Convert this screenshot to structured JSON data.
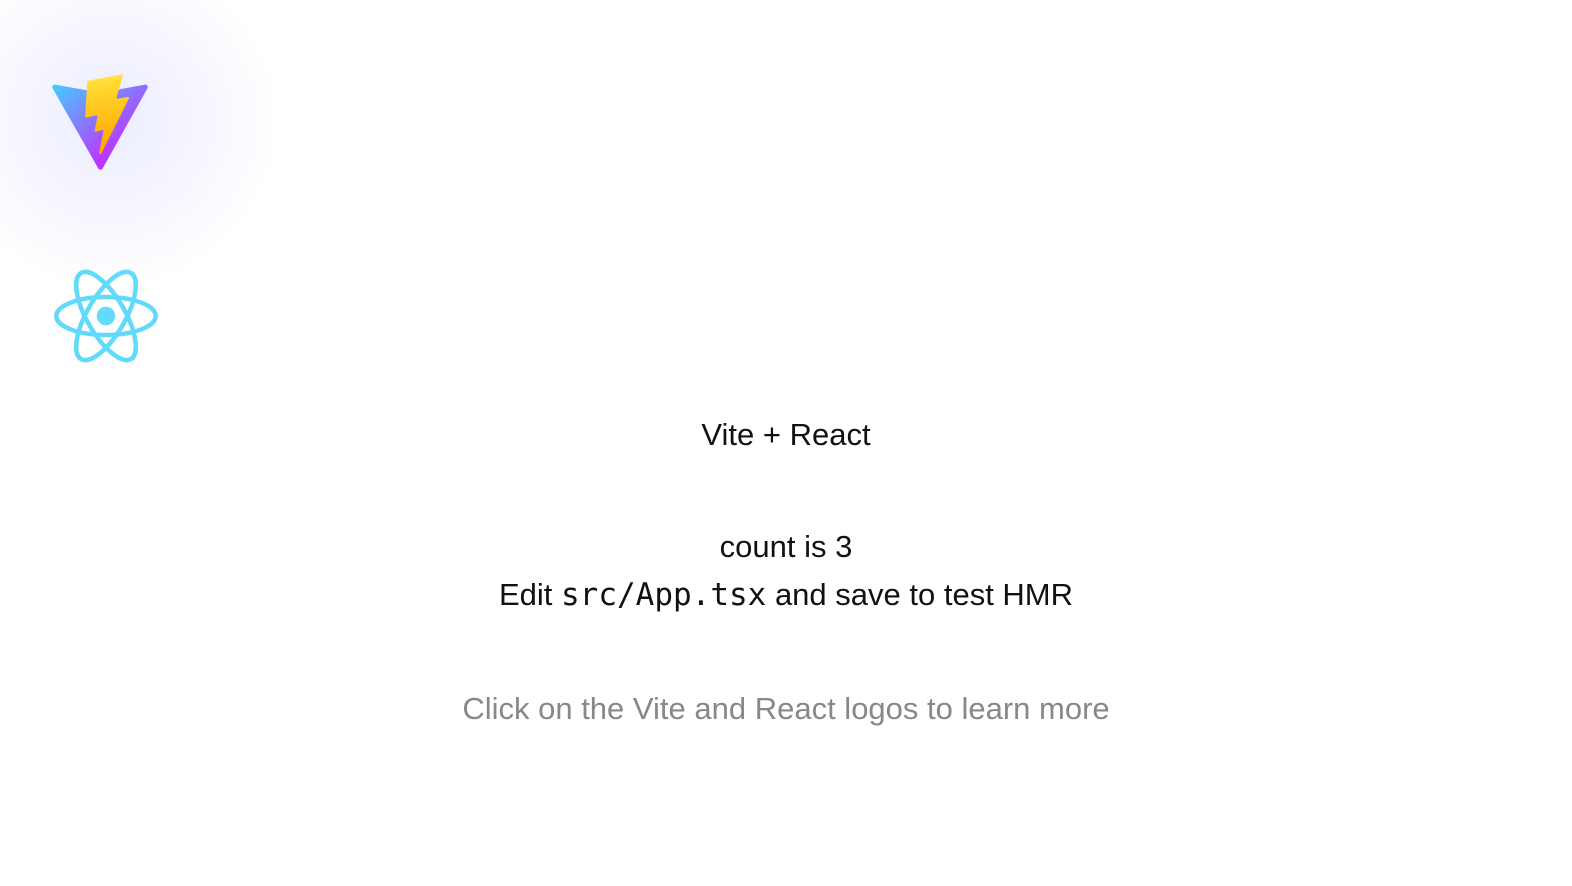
{
  "logos": {
    "vite": {
      "icon": "vite-logo-icon"
    },
    "react": {
      "icon": "react-logo-icon",
      "color": "#61dafb"
    }
  },
  "title": "Vite + React",
  "counter": {
    "label": "count is 3"
  },
  "hmr": {
    "prefix": "Edit ",
    "code": "src/App.tsx",
    "suffix": " and save to test HMR"
  },
  "footer": {
    "text": "Click on the Vite and React logos to learn more",
    "color": "#888888"
  }
}
